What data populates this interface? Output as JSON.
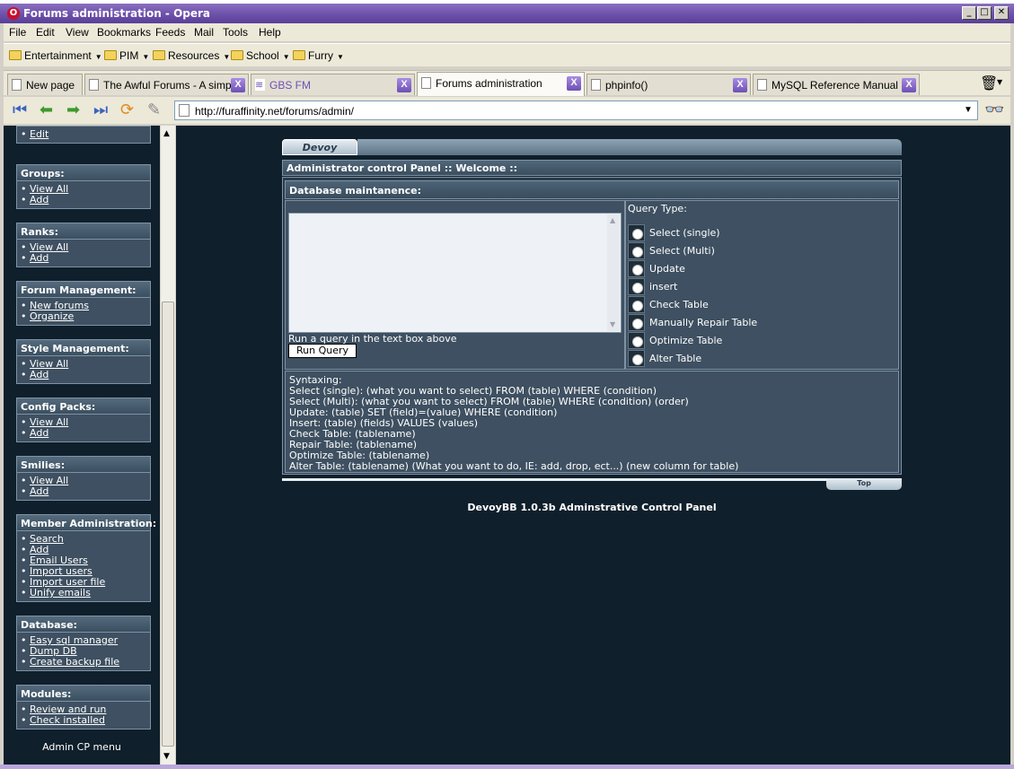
{
  "window": {
    "title": "Forums administration - Opera"
  },
  "menu": [
    "File",
    "Edit",
    "View",
    "Bookmarks",
    "Feeds",
    "Mail",
    "Tools",
    "Help"
  ],
  "bookmarks": [
    "Entertainment",
    "PIM",
    "Resources",
    "School",
    "Furry"
  ],
  "tabs": [
    {
      "label": "New page"
    },
    {
      "label": "The Awful Forums - A simp..."
    },
    {
      "label": "GBS FM"
    },
    {
      "label": "Forums administration"
    },
    {
      "label": "phpinfo()"
    },
    {
      "label": "MySQL Reference Manual ..."
    }
  ],
  "address": {
    "url": "http://furaffinity.net/forums/admin/"
  },
  "sidebar": {
    "top_link": "Edit",
    "sections": [
      {
        "title": "Groups:",
        "links": [
          "View All",
          "Add"
        ]
      },
      {
        "title": "Ranks:",
        "links": [
          "View All",
          "Add"
        ]
      },
      {
        "title": "Forum Management:",
        "links": [
          "New forums",
          "Organize"
        ]
      },
      {
        "title": "Style Management:",
        "links": [
          "View All",
          "Add"
        ]
      },
      {
        "title": "Config Packs:",
        "links": [
          "View All",
          "Add"
        ]
      },
      {
        "title": "Smilies:",
        "links": [
          "View All",
          "Add"
        ]
      },
      {
        "title": "Member Administration:",
        "links": [
          "Search",
          "Add",
          "Email Users",
          "Import users",
          "Import user file",
          "Unify emails"
        ]
      },
      {
        "title": "Database:",
        "links": [
          "Easy sql manager",
          "Dump DB",
          "Create backup file"
        ]
      },
      {
        "title": "Modules:",
        "links": [
          "Review and run",
          "Check installed"
        ]
      }
    ],
    "footer": "Admin CP menu"
  },
  "panel": {
    "brand": "Devoy",
    "welcome": "Administrator control Panel :: Welcome ::",
    "section_title": "Database maintanence:",
    "query_hint": "Run a query in the text box above",
    "run_button": "Run Query",
    "query_type_label": "Query Type:",
    "query_types": [
      "Select (single)",
      "Select (Multi)",
      "Update",
      "insert",
      "Check Table",
      "Manually Repair Table",
      "Optimize Table",
      "Alter Table"
    ],
    "syntax_lines": [
      "Syntaxing:",
      "Select (single): (what you want to select) FROM (table) WHERE (condition)",
      "Select (Multi): (what you want to select) FROM (table) WHERE (condition) (order)",
      "Update: (table) SET (field)=(value) WHERE (condition)",
      "Insert: (table) (fields) VALUES (values)",
      "Check Table: (tablename)",
      "Repair Table: (tablename)",
      "Optimize Table: (tablename)",
      "Alter Table: (tablename) (What you want to do, IE: add, drop, ect...) (new column for table)"
    ],
    "top_label": "Top",
    "footer": "DevoyBB 1.0.3b Adminstrative Control Panel"
  }
}
